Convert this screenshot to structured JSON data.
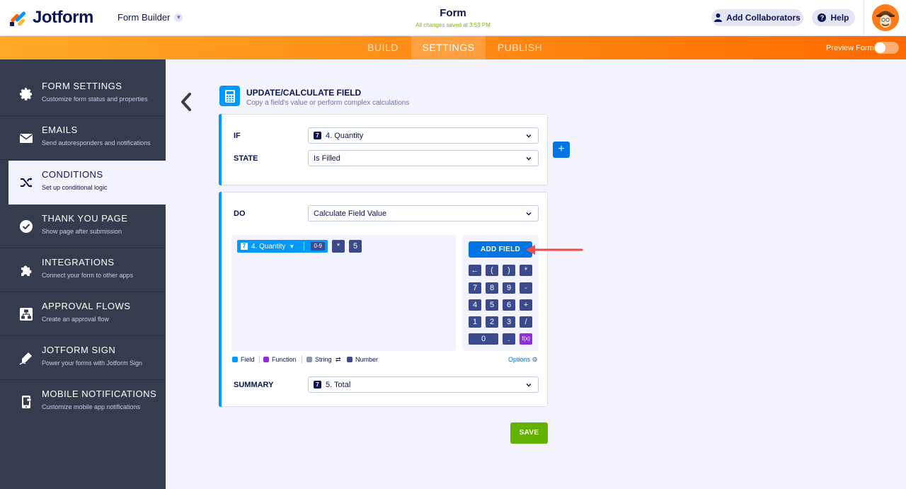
{
  "header": {
    "brand": "Jotform",
    "builder_menu": "Form Builder",
    "form_title": "Form",
    "saved_note": "All changes saved at 3:53 PM",
    "collaborators_label": "Add Collaborators",
    "help_label": "Help"
  },
  "nav": {
    "tabs": [
      {
        "label": "BUILD",
        "active": false
      },
      {
        "label": "SETTINGS",
        "active": true
      },
      {
        "label": "PUBLISH",
        "active": false
      }
    ],
    "preview_label": "Preview Form"
  },
  "sidebar": {
    "items": [
      {
        "title": "FORM SETTINGS",
        "subtitle": "Customize form status and properties",
        "icon": "gear-icon"
      },
      {
        "title": "EMAILS",
        "subtitle": "Send autoresponders and notifications",
        "icon": "envelope-icon"
      },
      {
        "title": "CONDITIONS",
        "subtitle": "Set up conditional logic",
        "icon": "shuffle-icon",
        "active": true
      },
      {
        "title": "THANK YOU PAGE",
        "subtitle": "Show page after submission",
        "icon": "check-circle-icon"
      },
      {
        "title": "INTEGRATIONS",
        "subtitle": "Connect your form to other apps",
        "icon": "puzzle-icon"
      },
      {
        "title": "APPROVAL FLOWS",
        "subtitle": "Create an approval flow",
        "icon": "flow-icon"
      },
      {
        "title": "JOTFORM SIGN",
        "subtitle": "Power your forms with Jotform Sign",
        "icon": "pen-icon"
      },
      {
        "title": "MOBILE NOTIFICATIONS",
        "subtitle": "Customize mobile app notifications",
        "icon": "mobile-icon"
      }
    ]
  },
  "condition": {
    "title": "UPDATE/CALCULATE FIELD",
    "subtitle": "Copy a field's value or perform complex calculations",
    "if_label": "IF",
    "if_value": "4. Quantity",
    "state_label": "STATE",
    "state_value": "Is Filled",
    "do_label": "DO",
    "do_value": "Calculate Field Value",
    "summary_label": "SUMMARY",
    "summary_value": "5. Total",
    "field_tag": "7",
    "save_label": "SAVE"
  },
  "calculation": {
    "field_chip": "4. Quantity",
    "field_range": "0-9",
    "operator": "*",
    "number": "5",
    "add_field_label": "ADD FIELD",
    "keypad": [
      "←",
      "(",
      ")",
      "*",
      "7",
      "8",
      "9",
      "-",
      "4",
      "5",
      "6",
      "+",
      "1",
      "2",
      "3",
      "/",
      "0",
      ".",
      "f(x)"
    ],
    "legend": [
      {
        "label": "Field",
        "color": "#0099ff"
      },
      {
        "label": "Function",
        "color": "#8d2fd4"
      },
      {
        "label": "String",
        "color": "#8f96b2"
      },
      {
        "label": "Number",
        "color": "#3a4a8a"
      }
    ],
    "legend_swap": "⇄",
    "options_label": "Options"
  },
  "colors": {
    "accent": "#0099ff",
    "primary_button": "#0075e3",
    "save_button": "#64b200",
    "sidebar_bg": "#343c4d"
  }
}
